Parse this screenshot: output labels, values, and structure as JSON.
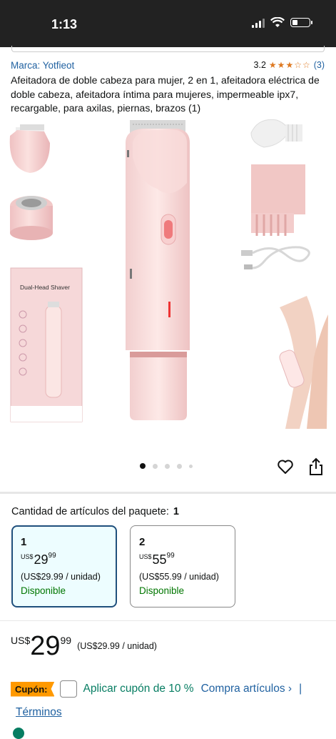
{
  "status_bar": {
    "time": "1:13"
  },
  "product": {
    "brand": "Marca: Yotfieot",
    "rating_value": "3.2",
    "stars": "★★★☆☆",
    "rating_count": "(3)",
    "title": "Afeitadora de doble cabeza para mujer, 2 en 1, afeitadora eléctrica de doble cabeza, afeitadora íntima para mujeres, impermeable ipx7, recargable, para axilas, piernas, brazos (1)",
    "box_label": "Dual-Head Shaver"
  },
  "gallery": {
    "image_count": 5,
    "active_index": 0
  },
  "package": {
    "label": "Cantidad de artículos del paquete:",
    "selected": "1",
    "options": [
      {
        "qty": "1",
        "currency": "US$",
        "whole": "29",
        "fraction": "99",
        "unit_price": "(US$29.99 / unidad)",
        "availability": "Disponible"
      },
      {
        "qty": "2",
        "currency": "US$",
        "whole": "55",
        "fraction": "99",
        "unit_price": "(US$55.99 / unidad)",
        "availability": "Disponible"
      }
    ]
  },
  "price": {
    "currency": "US$",
    "whole": "29",
    "fraction": "99",
    "unit_price": "(US$29.99 / unidad)"
  },
  "coupon": {
    "badge": "Cupón:",
    "text": "Aplicar cupón de 10 %",
    "link": "Compra artículos ›",
    "sep": "|",
    "terms": "Términos"
  },
  "colors": {
    "link": "#2162a1",
    "in_stock": "#007600",
    "coupon_badge": "#ff9900",
    "selected_border": "#1f4f7c"
  }
}
